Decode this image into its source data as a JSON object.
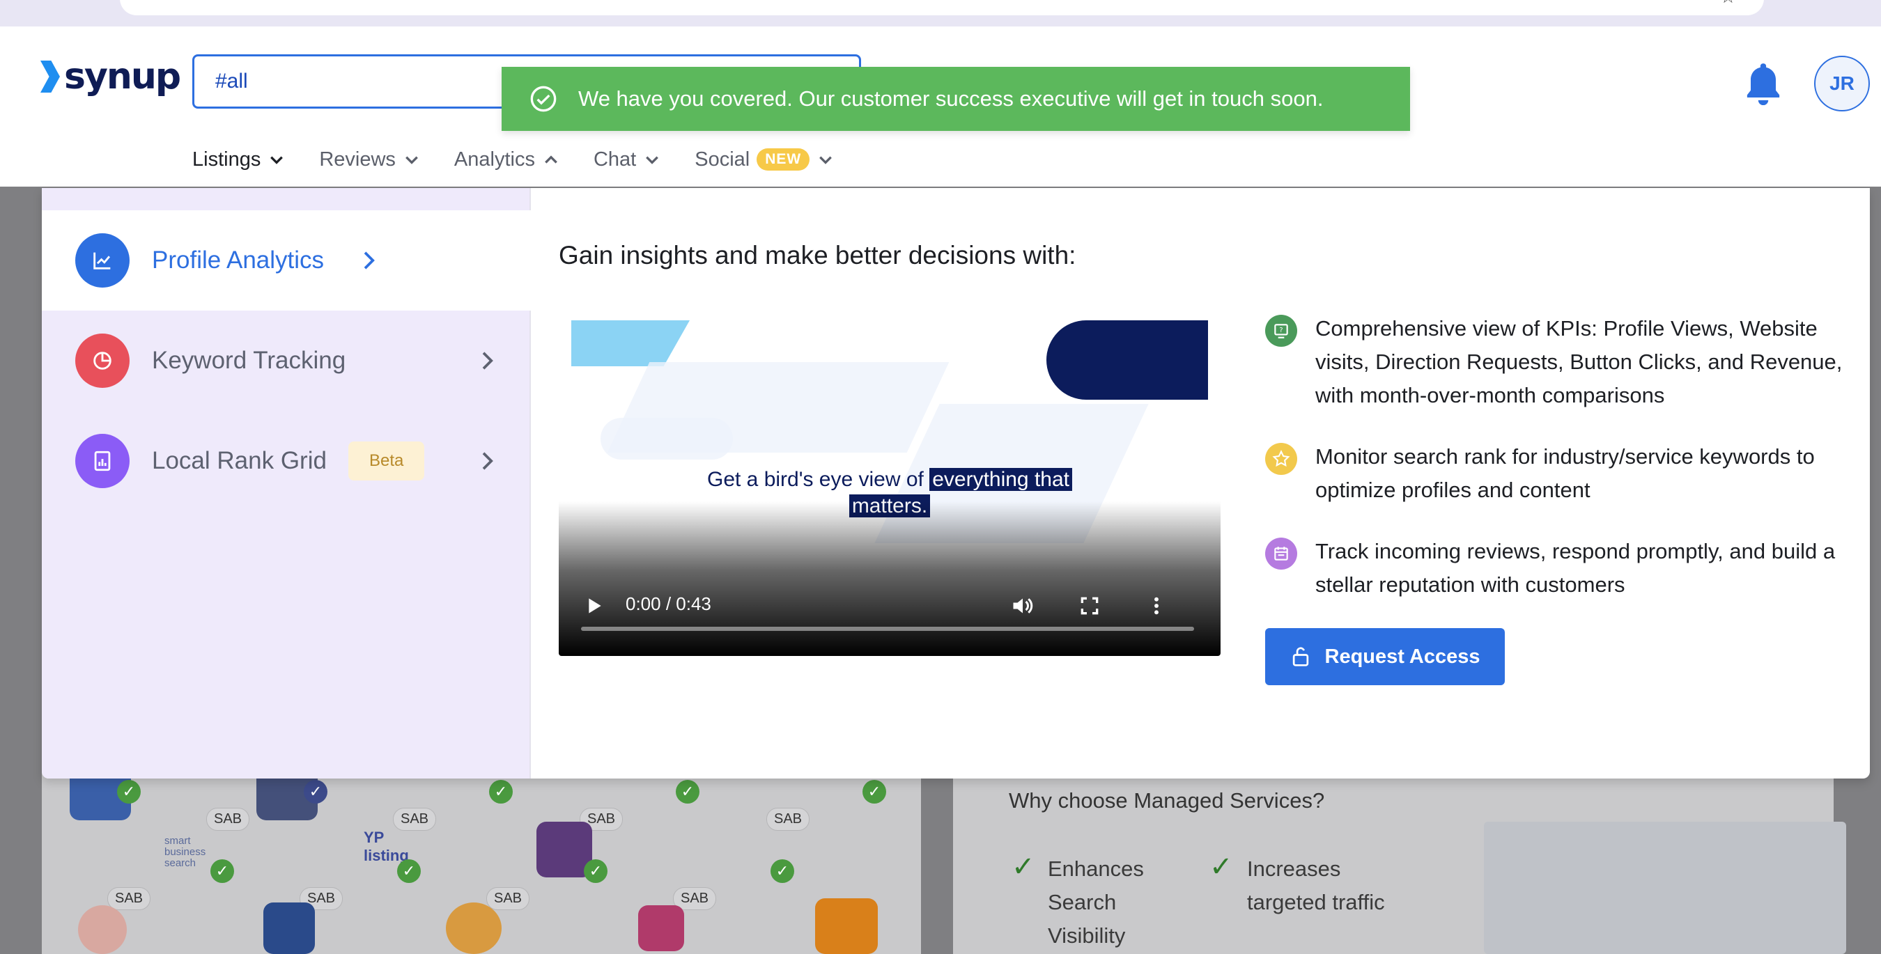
{
  "brand": {
    "name": "synup",
    "accent": "#2d6fe0",
    "logo_color": "#1f8ef0",
    "text_color": "#0f1c55"
  },
  "header": {
    "search_value": "#all",
    "avatar_initials": "JR"
  },
  "toast": {
    "message": "We have you covered. Our customer success executive will get in touch soon.",
    "color": "#5cb85c"
  },
  "nav": {
    "items": [
      {
        "label": "Listings",
        "active": true
      },
      {
        "label": "Reviews"
      },
      {
        "label": "Analytics"
      },
      {
        "label": "Chat"
      },
      {
        "label": "Social",
        "badge": "NEW"
      }
    ]
  },
  "menu": {
    "items": [
      {
        "label": "Profile Analytics",
        "icon": "line-chart-icon",
        "active": true
      },
      {
        "label": "Keyword Tracking",
        "icon": "pie-chart-icon"
      },
      {
        "label": "Local Rank Grid",
        "icon": "report-icon",
        "badge": "Beta"
      }
    ],
    "heading": "Gain insights and make better decisions with:",
    "video": {
      "caption_plain": "Get a bird's eye view of",
      "caption_highlight_1": "everything that",
      "caption_highlight_2": "matters.",
      "time": "0:00 / 0:43"
    },
    "features": [
      {
        "icon": "kpi-icon",
        "text": "Comprehensive view of KPIs: Profile Views, Website visits, Direction Requests, Button Clicks, and Revenue, with month-over-month comparisons",
        "color": "#4a9a5a"
      },
      {
        "icon": "star-icon",
        "text": "Monitor search rank for industry/service keywords to optimize profiles and content",
        "color": "#f2c94c"
      },
      {
        "icon": "calendar-icon",
        "text": "Track incoming reviews, respond promptly, and build a stellar reputation with customers",
        "color": "#b57be0"
      }
    ],
    "request_button": "Request Access"
  },
  "background": {
    "sab_label": "SAB",
    "listing_logos": [
      "smart business search",
      "YP listing"
    ],
    "why_title": "Why choose Managed Services?",
    "benefits": [
      "Enhances Search Visibility",
      "Increases targeted traffic"
    ]
  }
}
